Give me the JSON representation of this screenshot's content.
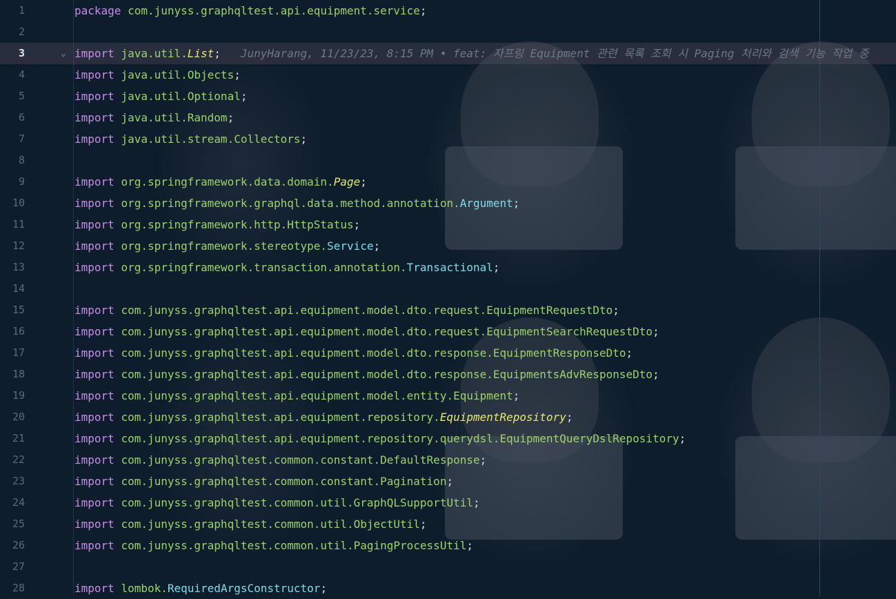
{
  "editor": {
    "current_line": 3,
    "blame": {
      "line": 3,
      "text": "JunyHarang, 11/23/23, 8:15 PM • feat: 자프링 Equipment 관련 목록 조회 시 Paging 처리와 검색 기능 작업 중"
    },
    "lines": [
      {
        "n": "1",
        "kw": "package",
        "pkg": "com.junyss.graphqltest.api.equipment.service",
        "cls": "",
        "style": "",
        "end": ";"
      },
      {
        "n": "2",
        "kw": "",
        "pkg": "",
        "cls": "",
        "style": "",
        "end": ""
      },
      {
        "n": "3",
        "kw": "import",
        "pkg": "java.util.",
        "cls": "List",
        "style": "italic",
        "end": ";"
      },
      {
        "n": "4",
        "kw": "import",
        "pkg": "java.util.Objects",
        "cls": "",
        "style": "",
        "end": ";"
      },
      {
        "n": "5",
        "kw": "import",
        "pkg": "java.util.Optional",
        "cls": "",
        "style": "",
        "end": ";"
      },
      {
        "n": "6",
        "kw": "import",
        "pkg": "java.util.Random",
        "cls": "",
        "style": "",
        "end": ";"
      },
      {
        "n": "7",
        "kw": "import",
        "pkg": "java.util.stream.Collectors",
        "cls": "",
        "style": "",
        "end": ";"
      },
      {
        "n": "8",
        "kw": "",
        "pkg": "",
        "cls": "",
        "style": "",
        "end": ""
      },
      {
        "n": "9",
        "kw": "import",
        "pkg": "org.springframework.data.domain.",
        "cls": "Page",
        "style": "italic",
        "end": ";"
      },
      {
        "n": "10",
        "kw": "import",
        "pkg": "org.springframework.graphql.data.method.annotation.",
        "cls": "Argument",
        "style": "cyan",
        "end": ";"
      },
      {
        "n": "11",
        "kw": "import",
        "pkg": "org.springframework.http.HttpStatus",
        "cls": "",
        "style": "",
        "end": ";"
      },
      {
        "n": "12",
        "kw": "import",
        "pkg": "org.springframework.stereotype.",
        "cls": "Service",
        "style": "cyan",
        "end": ";"
      },
      {
        "n": "13",
        "kw": "import",
        "pkg": "org.springframework.transaction.annotation.",
        "cls": "Transactional",
        "style": "cyan",
        "end": ";"
      },
      {
        "n": "14",
        "kw": "",
        "pkg": "",
        "cls": "",
        "style": "",
        "end": ""
      },
      {
        "n": "15",
        "kw": "import",
        "pkg": "com.junyss.graphqltest.api.equipment.model.dto.request.EquipmentRequestDto",
        "cls": "",
        "style": "",
        "end": ";"
      },
      {
        "n": "16",
        "kw": "import",
        "pkg": "com.junyss.graphqltest.api.equipment.model.dto.request.EquipmentSearchRequestDto",
        "cls": "",
        "style": "",
        "end": ";"
      },
      {
        "n": "17",
        "kw": "import",
        "pkg": "com.junyss.graphqltest.api.equipment.model.dto.response.EquipmentResponseDto",
        "cls": "",
        "style": "",
        "end": ";"
      },
      {
        "n": "18",
        "kw": "import",
        "pkg": "com.junyss.graphqltest.api.equipment.model.dto.response.EquipmentsAdvResponseDto",
        "cls": "",
        "style": "",
        "end": ";"
      },
      {
        "n": "19",
        "kw": "import",
        "pkg": "com.junyss.graphqltest.api.equipment.model.entity.Equipment",
        "cls": "",
        "style": "",
        "end": ";"
      },
      {
        "n": "20",
        "kw": "import",
        "pkg": "com.junyss.graphqltest.api.equipment.repository.",
        "cls": "EquipmentRepository",
        "style": "italic",
        "end": ";"
      },
      {
        "n": "21",
        "kw": "import",
        "pkg": "com.junyss.graphqltest.api.equipment.repository.querydsl.EquipmentQueryDslRepository",
        "cls": "",
        "style": "",
        "end": ";"
      },
      {
        "n": "22",
        "kw": "import",
        "pkg": "com.junyss.graphqltest.common.constant.DefaultResponse",
        "cls": "",
        "style": "",
        "end": ";"
      },
      {
        "n": "23",
        "kw": "import",
        "pkg": "com.junyss.graphqltest.common.constant.Pagination",
        "cls": "",
        "style": "",
        "end": ";"
      },
      {
        "n": "24",
        "kw": "import",
        "pkg": "com.junyss.graphqltest.common.util.GraphQLSupportUtil",
        "cls": "",
        "style": "",
        "end": ";"
      },
      {
        "n": "25",
        "kw": "import",
        "pkg": "com.junyss.graphqltest.common.util.ObjectUtil",
        "cls": "",
        "style": "",
        "end": ";"
      },
      {
        "n": "26",
        "kw": "import",
        "pkg": "com.junyss.graphqltest.common.util.PagingProcessUtil",
        "cls": "",
        "style": "",
        "end": ";"
      },
      {
        "n": "27",
        "kw": "",
        "pkg": "",
        "cls": "",
        "style": "",
        "end": ""
      },
      {
        "n": "28",
        "kw": "import",
        "pkg": "lombok.",
        "cls": "RequiredArgsConstructor",
        "style": "cyan",
        "end": ";"
      }
    ]
  },
  "icons": {
    "fold": "chevron-down-icon"
  }
}
